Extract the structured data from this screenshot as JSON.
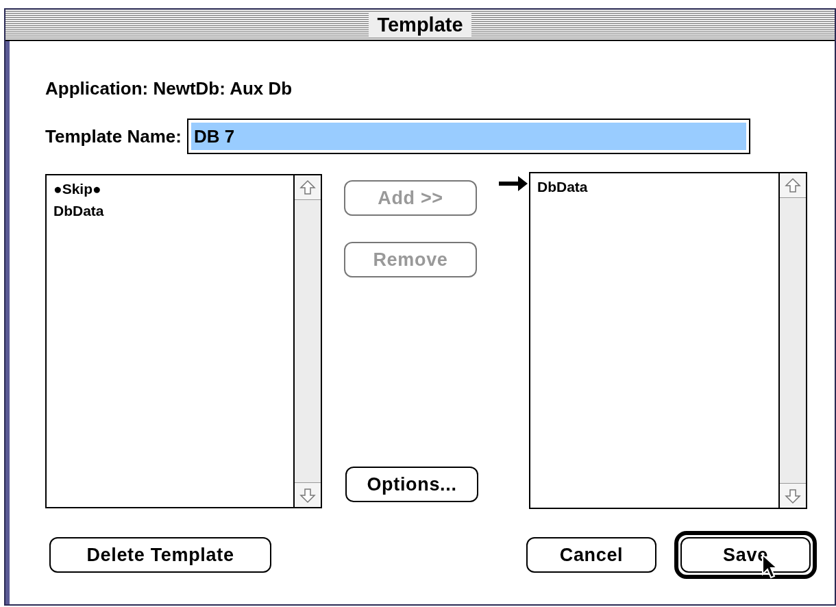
{
  "window": {
    "title": "Template"
  },
  "application_label": "Application: NewtDb: Aux Db",
  "template_name": {
    "label": "Template Name:",
    "value": "DB 7",
    "text_selected": true
  },
  "source_list": {
    "items": [
      {
        "label": "●Skip●"
      },
      {
        "label": "DbData"
      }
    ]
  },
  "middle_buttons": [
    {
      "label": "Add >>",
      "disabled": true
    },
    {
      "label": "Remove",
      "disabled": true
    },
    {
      "label": "Options...",
      "disabled": false
    }
  ],
  "target_list": {
    "insertion_arrow": true,
    "items": [
      {
        "label": "DbData"
      }
    ]
  },
  "bottom_buttons": [
    {
      "label": "Delete Template",
      "default": false
    },
    {
      "label": "Cancel",
      "default": false
    },
    {
      "label": "Save",
      "default": true,
      "cursor": true
    }
  ]
}
